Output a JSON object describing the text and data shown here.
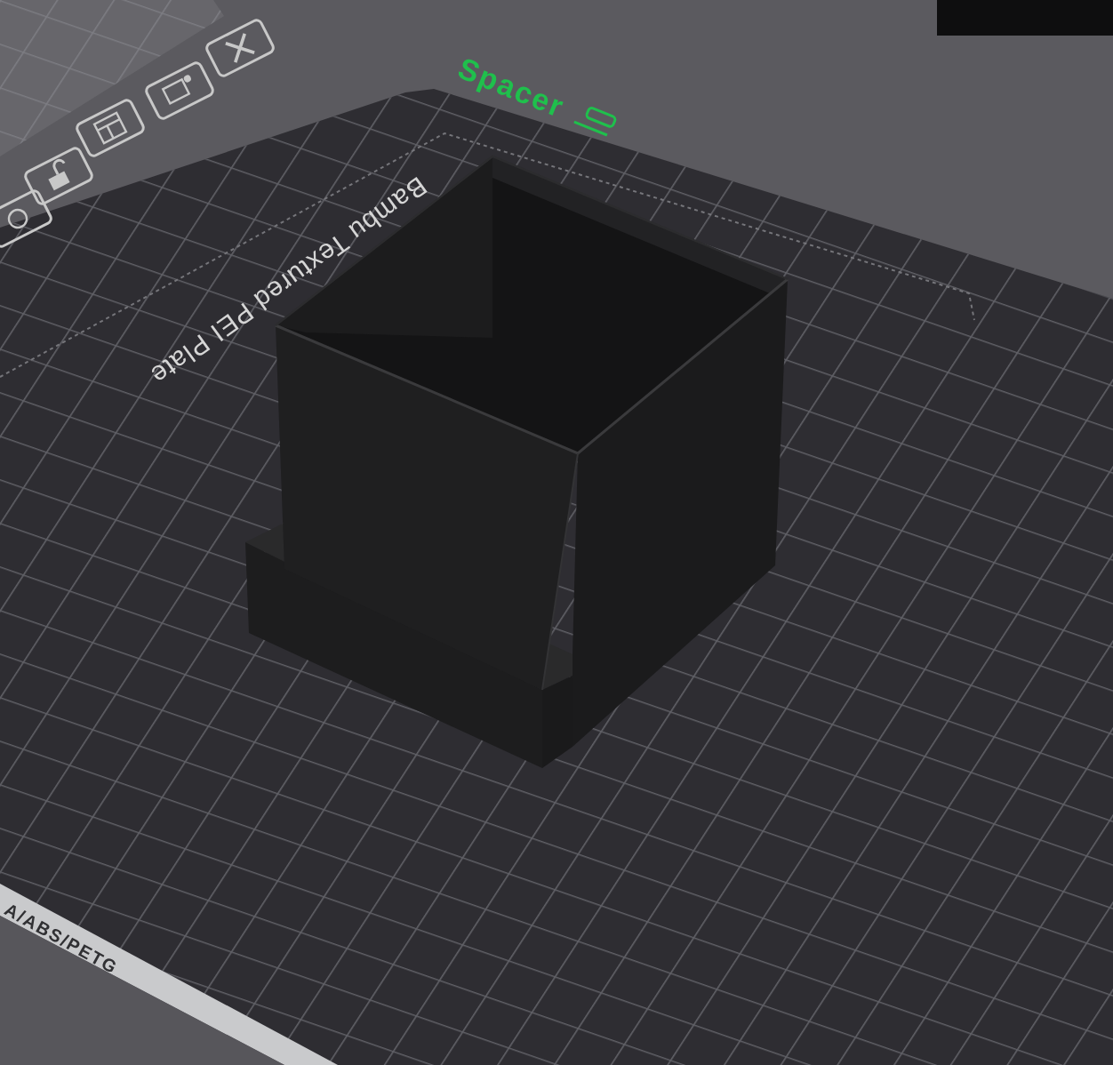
{
  "object": {
    "name": "Spacer"
  },
  "plate": {
    "name": "Bambu Textured PEI Plate",
    "filament": "A/ABS/PETG"
  }
}
